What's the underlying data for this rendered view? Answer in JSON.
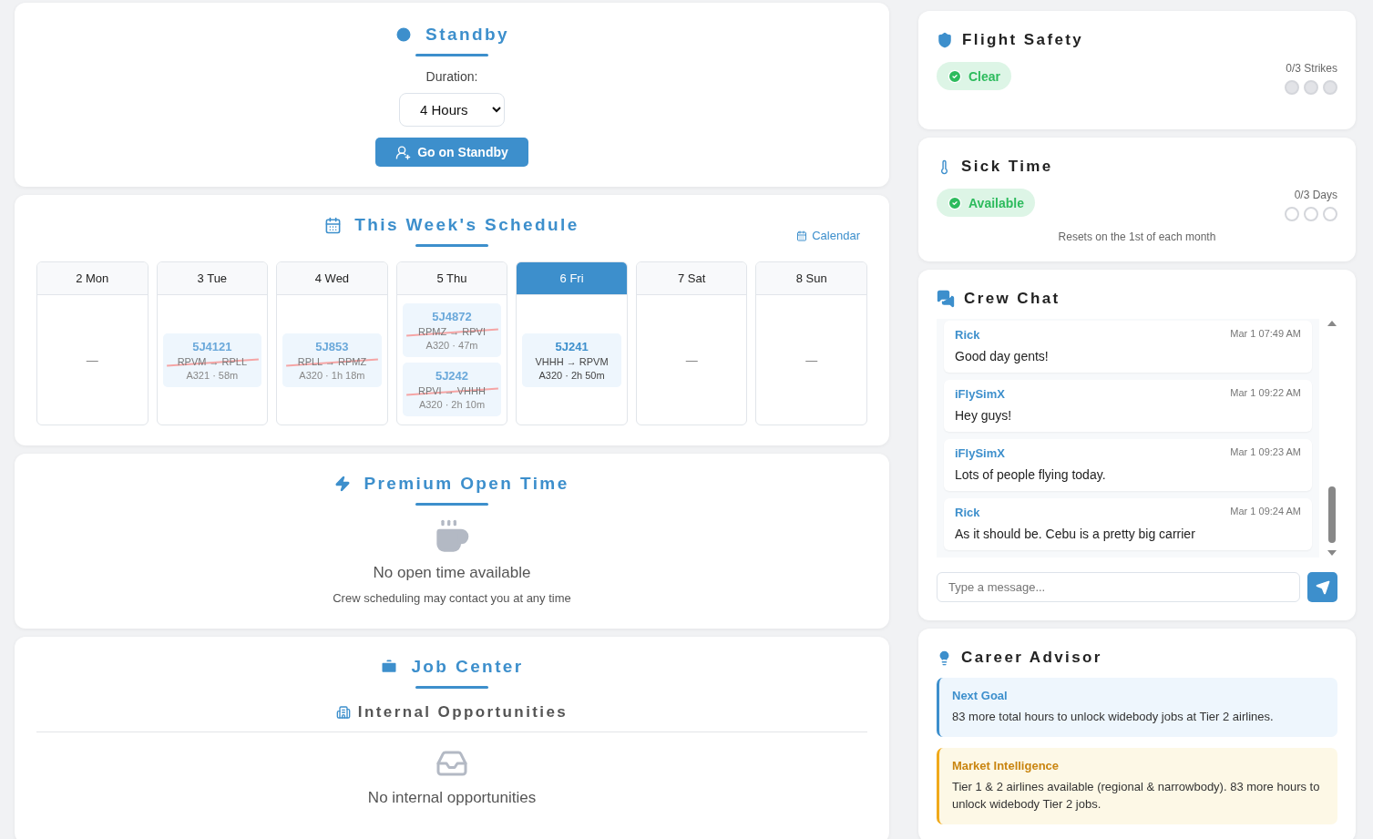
{
  "standby": {
    "title": "Standby",
    "duration_label": "Duration:",
    "duration_value": "4 Hours",
    "button": "Go on Standby"
  },
  "schedule": {
    "title": "This Week's Schedule",
    "calendar_link": "Calendar",
    "days": [
      {
        "label": "2 Mon",
        "selected": false,
        "empty": "—"
      },
      {
        "label": "3 Tue",
        "selected": false,
        "flights": [
          {
            "number": "5J4121",
            "route": "RPVM → RPLL",
            "details": "A321 · 58m",
            "cancelled": true
          }
        ]
      },
      {
        "label": "4 Wed",
        "selected": false,
        "flights": [
          {
            "number": "5J853",
            "route": "RPLL → RPMZ",
            "details": "A320 · 1h 18m",
            "cancelled": true
          }
        ]
      },
      {
        "label": "5 Thu",
        "selected": false,
        "flights": [
          {
            "number": "5J4872",
            "route": "RPMZ → RPVI",
            "details": "A320 · 47m",
            "cancelled": true
          },
          {
            "number": "5J242",
            "route": "RPVI → VHHH",
            "details": "A320 · 2h 10m",
            "cancelled": true
          }
        ]
      },
      {
        "label": "6 Fri",
        "selected": true,
        "flights": [
          {
            "number": "5J241",
            "route": "VHHH → RPVM",
            "details": "A320 · 2h 50m",
            "cancelled": false
          }
        ]
      },
      {
        "label": "7 Sat",
        "selected": false,
        "empty": "—"
      },
      {
        "label": "8 Sun",
        "selected": false,
        "empty": "—"
      }
    ]
  },
  "open_time": {
    "title": "Premium Open Time",
    "message": "No open time available",
    "note": "Crew scheduling may contact you at any time"
  },
  "job_center": {
    "title": "Job Center",
    "subtitle": "Internal Opportunities",
    "message": "No internal opportunities"
  },
  "flight_safety": {
    "title": "Flight Safety",
    "status": {
      "label": "Clear",
      "kind": "ok"
    },
    "count": "0/3 Strikes",
    "dots": [
      {
        "used": false
      },
      {
        "used": false
      },
      {
        "used": false
      }
    ]
  },
  "sick_time": {
    "title": "Sick Time",
    "status": {
      "label": "Available",
      "kind": "ok"
    },
    "count": "0/3 Days",
    "dots": [
      {
        "used": false
      },
      {
        "used": false
      },
      {
        "used": false
      }
    ],
    "note": "Resets on the 1st of each month"
  },
  "crew_chat": {
    "title": "Crew Chat",
    "messages": [
      {
        "author": "Rick",
        "time": "Mar 1 07:49 AM",
        "text": "Good day gents!"
      },
      {
        "author": "iFlySimX",
        "time": "Mar 1 09:22 AM",
        "text": "Hey guys!"
      },
      {
        "author": "iFlySimX",
        "time": "Mar 1 09:23 AM",
        "text": "Lots of people flying today."
      },
      {
        "author": "Rick",
        "time": "Mar 1 09:24 AM",
        "text": "As it should be. Cebu is a pretty big carrier"
      }
    ],
    "placeholder": "Type a message..."
  },
  "career_advisor": {
    "title": "Career Advisor",
    "notes": [
      {
        "kind": "goal",
        "title": "Next Goal",
        "text": "83 more total hours to unlock widebody jobs at Tier 2 airlines."
      },
      {
        "kind": "market",
        "title": "Market Intelligence",
        "text": "Tier 1 & 2 airlines available (regional & narrowbody). 83 more hours to unlock widebody Tier 2 jobs."
      }
    ]
  }
}
